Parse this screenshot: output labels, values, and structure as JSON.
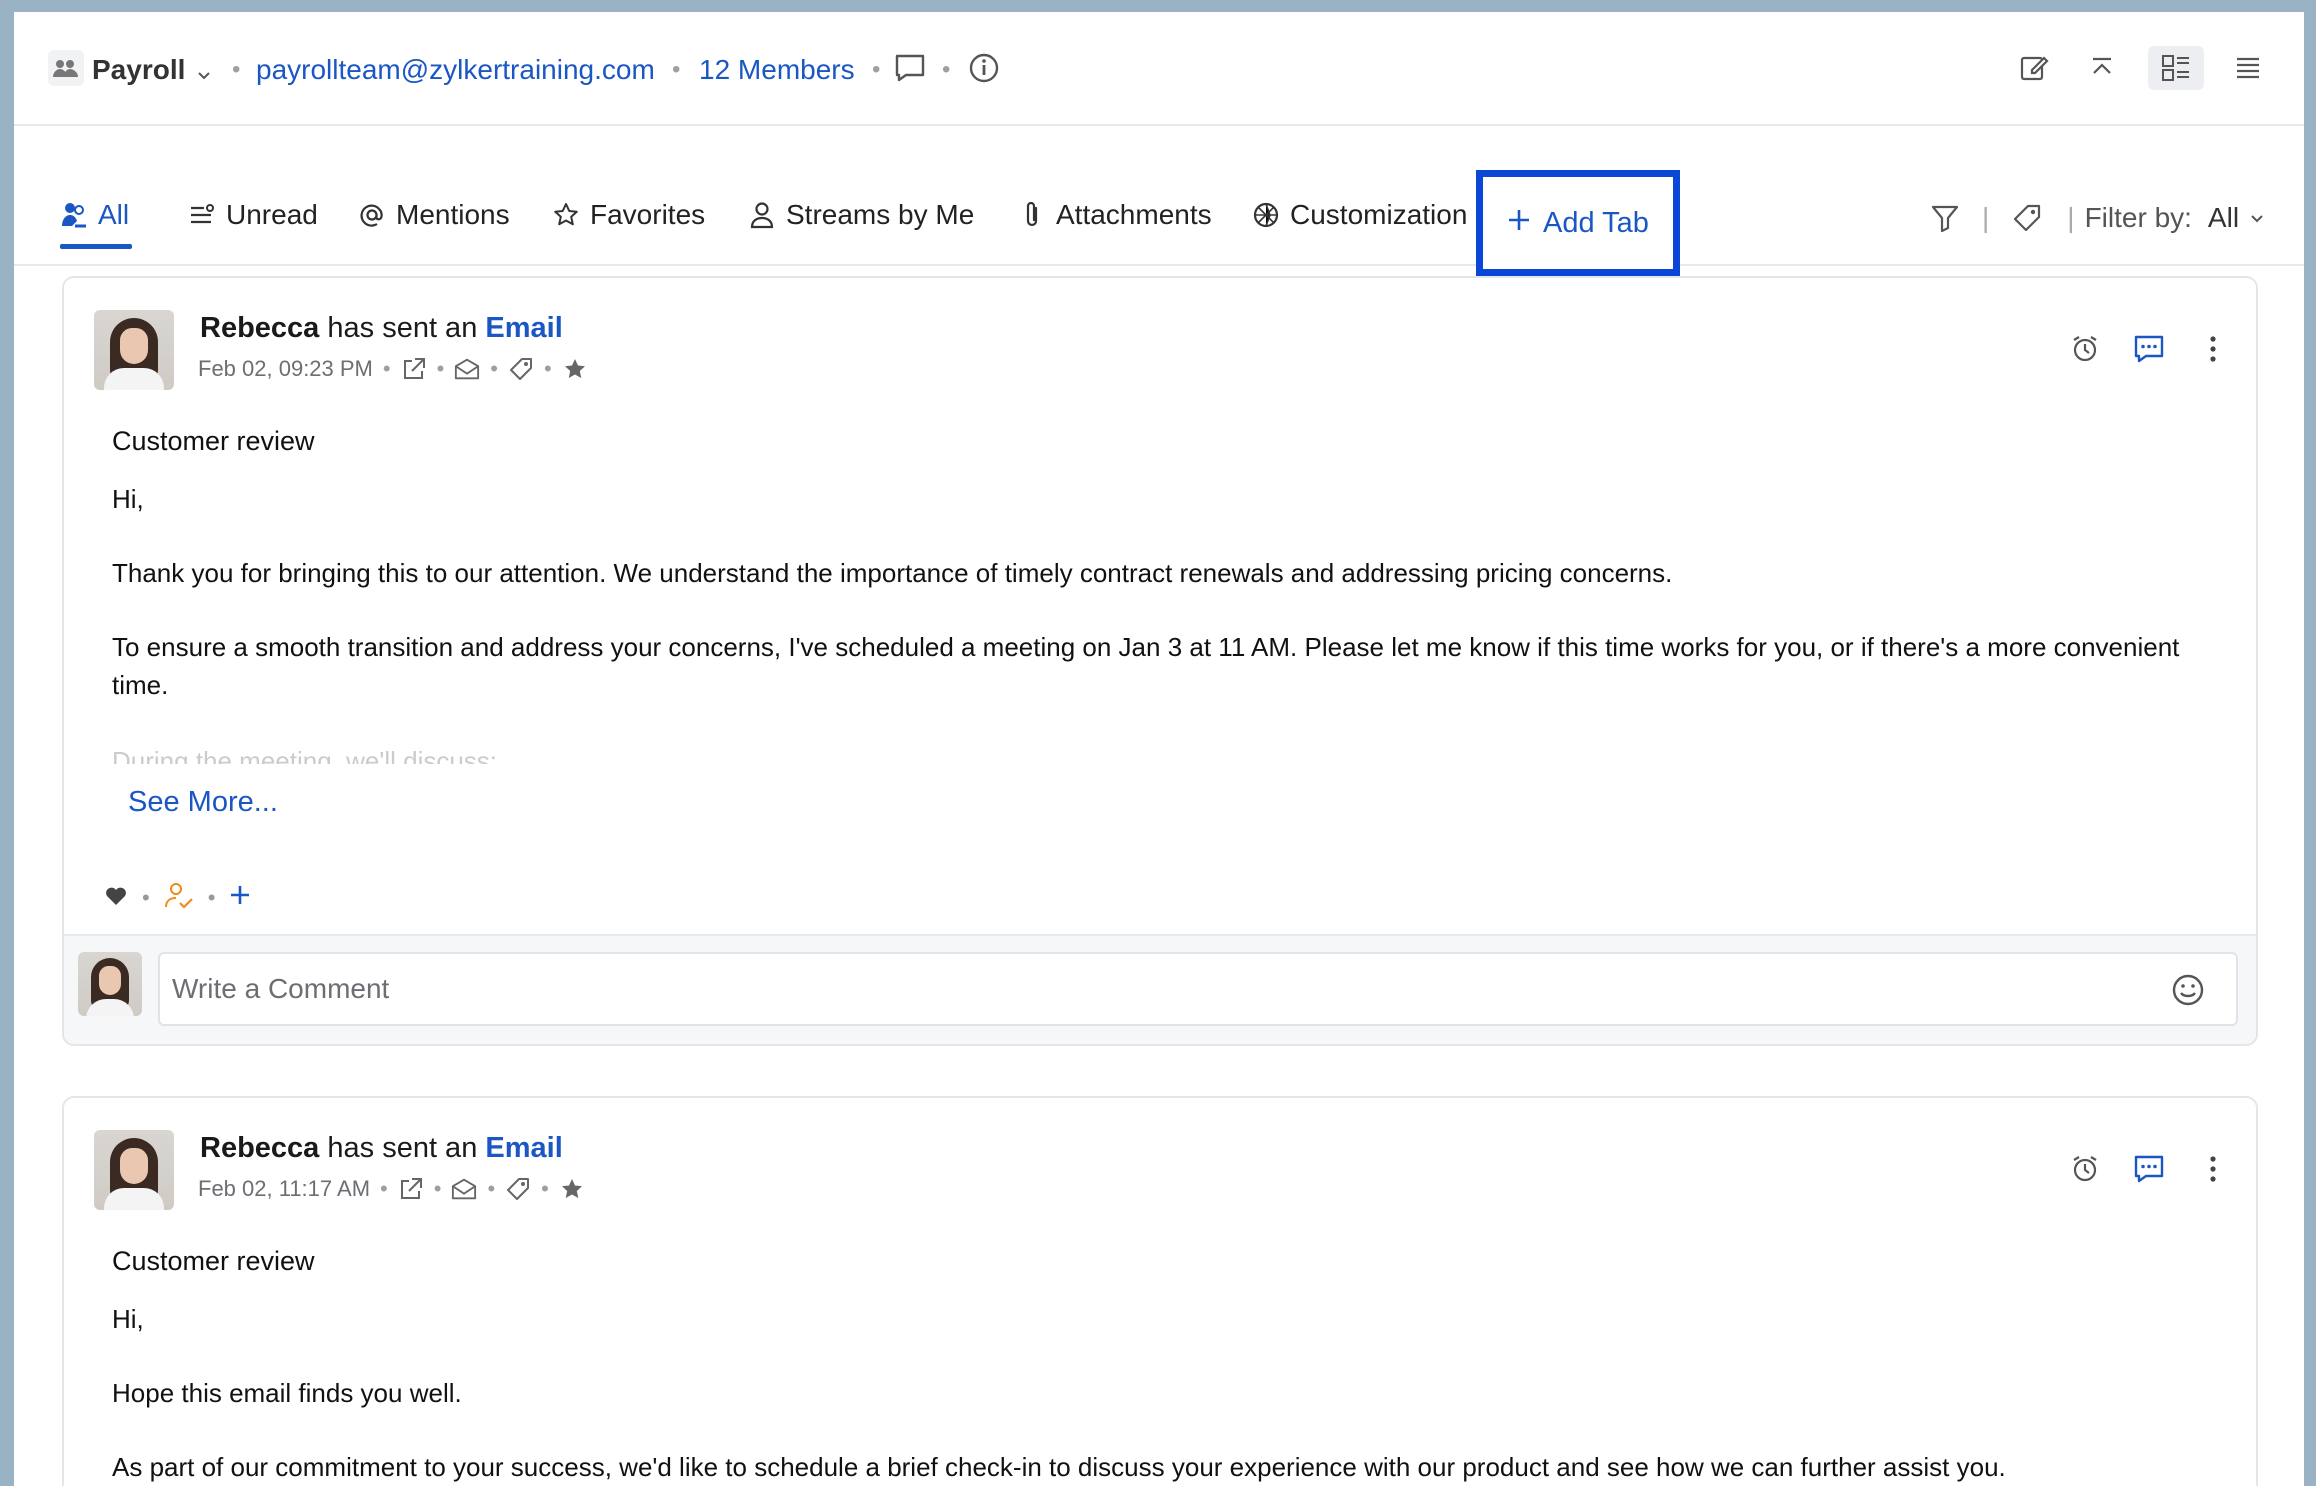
{
  "header": {
    "group_name": "Payroll",
    "email": "payrollteam@zylkertraining.com",
    "members": "12 Members"
  },
  "tabs": [
    {
      "label": "All",
      "icon": "people-icon",
      "active": true
    },
    {
      "label": "Unread",
      "icon": "unread-list-icon"
    },
    {
      "label": "Mentions",
      "icon": "at-icon"
    },
    {
      "label": "Favorites",
      "icon": "star-icon"
    },
    {
      "label": "Streams by Me",
      "icon": "person-icon"
    },
    {
      "label": "Attachments",
      "icon": "paperclip-icon"
    },
    {
      "label": "Customization",
      "icon": "customization-icon"
    }
  ],
  "add_tab": {
    "label": "Add Tab"
  },
  "filter": {
    "label": "Filter by:",
    "value": "All"
  },
  "posts": [
    {
      "sender": "Rebecca",
      "action": "has sent an",
      "type": "Email",
      "timestamp": "Feb 02, 09:23 PM",
      "subject": "Customer review",
      "greeting": "Hi,",
      "para1": "Thank you for bringing this to our attention. We understand the importance of timely contract renewals and addressing pricing concerns.",
      "para2": "To ensure a smooth transition and address your concerns, I've scheduled a meeting on Jan 3 at 11 AM. Please let me know if this time works for you, or if there's a more convenient time.",
      "faded": "During the meeting, we'll discuss:",
      "see_more": "See More...",
      "comment_placeholder": "Write a Comment"
    },
    {
      "sender": "Rebecca",
      "action": "has sent an",
      "type": "Email",
      "timestamp": "Feb 02, 11:17 AM",
      "subject": "Customer review",
      "greeting": "Hi,",
      "para1": "Hope this email finds you well.",
      "para2": "As part of our commitment to your success, we'd like to schedule a brief check-in to discuss your experience with our product and see how we can further assist you."
    }
  ],
  "colors": {
    "accent": "#1a56c4",
    "highlight_border": "#0a47d6"
  }
}
